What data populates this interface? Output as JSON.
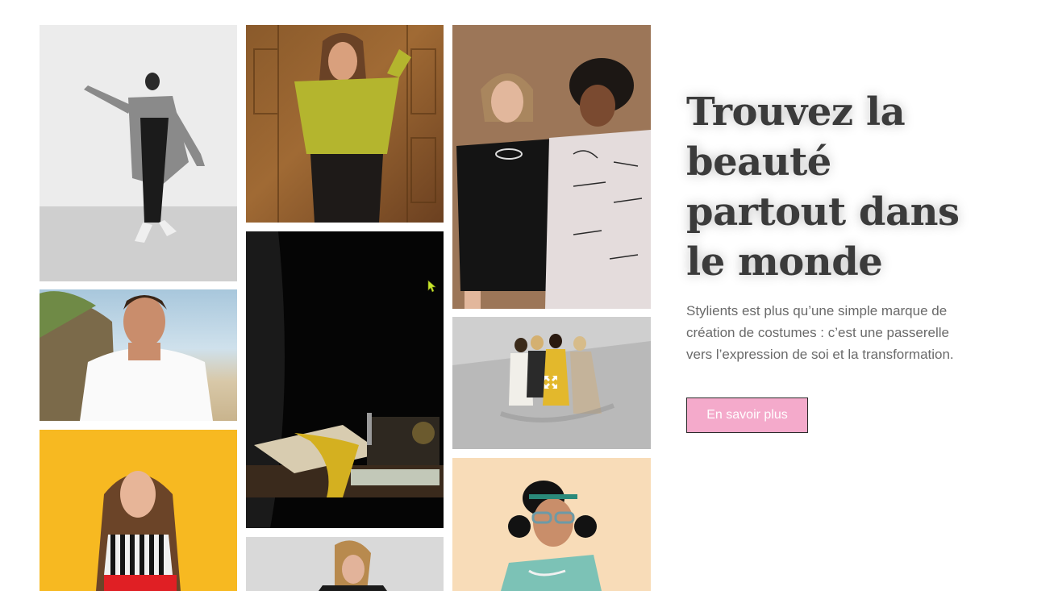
{
  "hero": {
    "title": "Trouvez la beauté partout dans le monde",
    "description": "Stylients est plus qu’une simple marque de création de costumes : c’est une passerelle vers l’expression de soi et la transformation.",
    "cta_label": "En savoir plus"
  },
  "colors": {
    "accent": "#f4aacb",
    "heading": "#3b3b3b",
    "body_text": "#6a6a6a"
  },
  "gallery": {
    "images": [
      {
        "subject": "dancer-black-white"
      },
      {
        "subject": "man-beach-white-tshirt"
      },
      {
        "subject": "woman-yellow-background"
      },
      {
        "subject": "woman-green-blouse-wood-door"
      },
      {
        "subject": "sewing-machine-dark"
      },
      {
        "subject": "woman-gray-background"
      },
      {
        "subject": "couple-graffiti-sweatshirts"
      },
      {
        "subject": "group-aerial-street"
      },
      {
        "subject": "woman-glasses-peach"
      }
    ],
    "icons": [
      "expand-icon",
      "cursor-icon"
    ]
  }
}
